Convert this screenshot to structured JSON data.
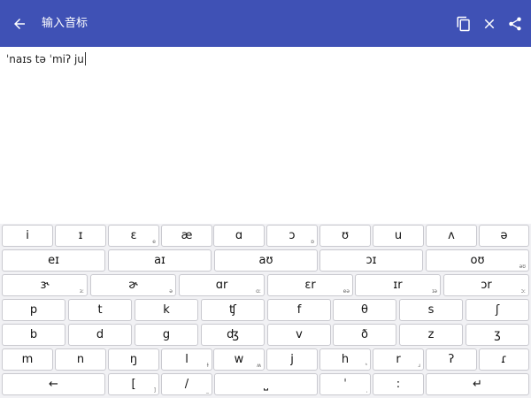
{
  "appbar": {
    "title": "输入音标",
    "icons": [
      "back-arrow-icon",
      "copy-icon",
      "close-icon",
      "share-icon"
    ]
  },
  "editor": {
    "text": "ˈnaɪs tə ˈmiʔ ju"
  },
  "keyboard": {
    "rows": [
      [
        {
          "label": "i",
          "sub": ""
        },
        {
          "label": "ɪ",
          "sub": ""
        },
        {
          "label": "ɛ",
          "sub": "e"
        },
        {
          "label": "æ",
          "sub": ""
        },
        {
          "label": "ɑ",
          "sub": ""
        },
        {
          "label": "ɔ",
          "sub": "ɒ"
        },
        {
          "label": "ʊ",
          "sub": ""
        },
        {
          "label": "u",
          "sub": ""
        },
        {
          "label": "ʌ",
          "sub": ""
        },
        {
          "label": "ə",
          "sub": ""
        }
      ],
      [
        {
          "label": "eɪ",
          "sub": ""
        },
        {
          "label": "aɪ",
          "sub": ""
        },
        {
          "label": "aʊ",
          "sub": ""
        },
        {
          "label": "ɔɪ",
          "sub": ""
        },
        {
          "label": "oʊ",
          "sub": "əʊ"
        }
      ],
      [
        {
          "label": "ɝ",
          "sub": "ɜː"
        },
        {
          "label": "ɚ",
          "sub": "ə"
        },
        {
          "label": "ɑr",
          "sub": "ɑː"
        },
        {
          "label": "ɛr",
          "sub": "eə"
        },
        {
          "label": "ɪr",
          "sub": "ɪə"
        },
        {
          "label": "ɔr",
          "sub": "ɔː"
        }
      ],
      [
        {
          "label": "p",
          "sub": ""
        },
        {
          "label": "t",
          "sub": ""
        },
        {
          "label": "k",
          "sub": ""
        },
        {
          "label": "ʧ",
          "sub": ""
        },
        {
          "label": "f",
          "sub": ""
        },
        {
          "label": "θ",
          "sub": ""
        },
        {
          "label": "s",
          "sub": ""
        },
        {
          "label": "ʃ",
          "sub": ""
        }
      ],
      [
        {
          "label": "b",
          "sub": ""
        },
        {
          "label": "d",
          "sub": ""
        },
        {
          "label": "g",
          "sub": ""
        },
        {
          "label": "ʤ",
          "sub": ""
        },
        {
          "label": "v",
          "sub": ""
        },
        {
          "label": "ð",
          "sub": ""
        },
        {
          "label": "z",
          "sub": ""
        },
        {
          "label": "ʒ",
          "sub": ""
        }
      ],
      [
        {
          "label": "m",
          "sub": ""
        },
        {
          "label": "n",
          "sub": ""
        },
        {
          "label": "ŋ",
          "sub": ""
        },
        {
          "label": "l",
          "sub": "ɫ"
        },
        {
          "label": "w",
          "sub": "ʍ"
        },
        {
          "label": "j",
          "sub": ""
        },
        {
          "label": "h",
          "sub": "ʰ"
        },
        {
          "label": "r",
          "sub": "ɹ"
        },
        {
          "label": "ʔ",
          "sub": ""
        },
        {
          "label": "ɾ",
          "sub": ""
        }
      ],
      [
        {
          "label": "←",
          "sub": ""
        },
        {
          "label": "[",
          "sub": "]"
        },
        {
          "label": "/",
          "sub": "_"
        },
        {
          "label": "⎵",
          "sub": ""
        },
        {
          "label": "ˈ",
          "sub": "ˌ"
        },
        {
          "label": ":",
          "sub": ""
        },
        {
          "label": "↵",
          "sub": ""
        }
      ]
    ]
  }
}
